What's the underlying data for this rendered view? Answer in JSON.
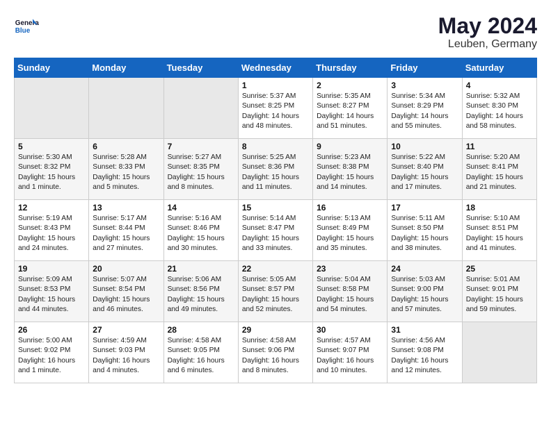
{
  "header": {
    "logo_general": "General",
    "logo_blue": "Blue",
    "month_year": "May 2024",
    "location": "Leuben, Germany"
  },
  "days_of_week": [
    "Sunday",
    "Monday",
    "Tuesday",
    "Wednesday",
    "Thursday",
    "Friday",
    "Saturday"
  ],
  "weeks": [
    [
      {
        "day": "",
        "info": ""
      },
      {
        "day": "",
        "info": ""
      },
      {
        "day": "",
        "info": ""
      },
      {
        "day": "1",
        "info": "Sunrise: 5:37 AM\nSunset: 8:25 PM\nDaylight: 14 hours\nand 48 minutes."
      },
      {
        "day": "2",
        "info": "Sunrise: 5:35 AM\nSunset: 8:27 PM\nDaylight: 14 hours\nand 51 minutes."
      },
      {
        "day": "3",
        "info": "Sunrise: 5:34 AM\nSunset: 8:29 PM\nDaylight: 14 hours\nand 55 minutes."
      },
      {
        "day": "4",
        "info": "Sunrise: 5:32 AM\nSunset: 8:30 PM\nDaylight: 14 hours\nand 58 minutes."
      }
    ],
    [
      {
        "day": "5",
        "info": "Sunrise: 5:30 AM\nSunset: 8:32 PM\nDaylight: 15 hours\nand 1 minute."
      },
      {
        "day": "6",
        "info": "Sunrise: 5:28 AM\nSunset: 8:33 PM\nDaylight: 15 hours\nand 5 minutes."
      },
      {
        "day": "7",
        "info": "Sunrise: 5:27 AM\nSunset: 8:35 PM\nDaylight: 15 hours\nand 8 minutes."
      },
      {
        "day": "8",
        "info": "Sunrise: 5:25 AM\nSunset: 8:36 PM\nDaylight: 15 hours\nand 11 minutes."
      },
      {
        "day": "9",
        "info": "Sunrise: 5:23 AM\nSunset: 8:38 PM\nDaylight: 15 hours\nand 14 minutes."
      },
      {
        "day": "10",
        "info": "Sunrise: 5:22 AM\nSunset: 8:40 PM\nDaylight: 15 hours\nand 17 minutes."
      },
      {
        "day": "11",
        "info": "Sunrise: 5:20 AM\nSunset: 8:41 PM\nDaylight: 15 hours\nand 21 minutes."
      }
    ],
    [
      {
        "day": "12",
        "info": "Sunrise: 5:19 AM\nSunset: 8:43 PM\nDaylight: 15 hours\nand 24 minutes."
      },
      {
        "day": "13",
        "info": "Sunrise: 5:17 AM\nSunset: 8:44 PM\nDaylight: 15 hours\nand 27 minutes."
      },
      {
        "day": "14",
        "info": "Sunrise: 5:16 AM\nSunset: 8:46 PM\nDaylight: 15 hours\nand 30 minutes."
      },
      {
        "day": "15",
        "info": "Sunrise: 5:14 AM\nSunset: 8:47 PM\nDaylight: 15 hours\nand 33 minutes."
      },
      {
        "day": "16",
        "info": "Sunrise: 5:13 AM\nSunset: 8:49 PM\nDaylight: 15 hours\nand 35 minutes."
      },
      {
        "day": "17",
        "info": "Sunrise: 5:11 AM\nSunset: 8:50 PM\nDaylight: 15 hours\nand 38 minutes."
      },
      {
        "day": "18",
        "info": "Sunrise: 5:10 AM\nSunset: 8:51 PM\nDaylight: 15 hours\nand 41 minutes."
      }
    ],
    [
      {
        "day": "19",
        "info": "Sunrise: 5:09 AM\nSunset: 8:53 PM\nDaylight: 15 hours\nand 44 minutes."
      },
      {
        "day": "20",
        "info": "Sunrise: 5:07 AM\nSunset: 8:54 PM\nDaylight: 15 hours\nand 46 minutes."
      },
      {
        "day": "21",
        "info": "Sunrise: 5:06 AM\nSunset: 8:56 PM\nDaylight: 15 hours\nand 49 minutes."
      },
      {
        "day": "22",
        "info": "Sunrise: 5:05 AM\nSunset: 8:57 PM\nDaylight: 15 hours\nand 52 minutes."
      },
      {
        "day": "23",
        "info": "Sunrise: 5:04 AM\nSunset: 8:58 PM\nDaylight: 15 hours\nand 54 minutes."
      },
      {
        "day": "24",
        "info": "Sunrise: 5:03 AM\nSunset: 9:00 PM\nDaylight: 15 hours\nand 57 minutes."
      },
      {
        "day": "25",
        "info": "Sunrise: 5:01 AM\nSunset: 9:01 PM\nDaylight: 15 hours\nand 59 minutes."
      }
    ],
    [
      {
        "day": "26",
        "info": "Sunrise: 5:00 AM\nSunset: 9:02 PM\nDaylight: 16 hours\nand 1 minute."
      },
      {
        "day": "27",
        "info": "Sunrise: 4:59 AM\nSunset: 9:03 PM\nDaylight: 16 hours\nand 4 minutes."
      },
      {
        "day": "28",
        "info": "Sunrise: 4:58 AM\nSunset: 9:05 PM\nDaylight: 16 hours\nand 6 minutes."
      },
      {
        "day": "29",
        "info": "Sunrise: 4:58 AM\nSunset: 9:06 PM\nDaylight: 16 hours\nand 8 minutes."
      },
      {
        "day": "30",
        "info": "Sunrise: 4:57 AM\nSunset: 9:07 PM\nDaylight: 16 hours\nand 10 minutes."
      },
      {
        "day": "31",
        "info": "Sunrise: 4:56 AM\nSunset: 9:08 PM\nDaylight: 16 hours\nand 12 minutes."
      },
      {
        "day": "",
        "info": ""
      }
    ]
  ]
}
